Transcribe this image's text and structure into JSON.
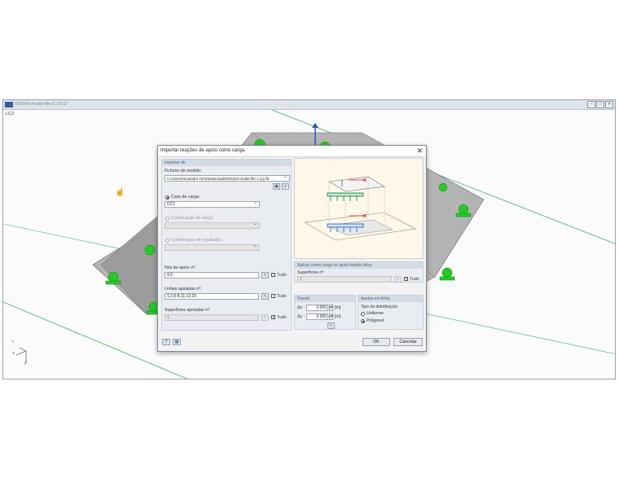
{
  "app": {
    "title": "001643-model-file-2_VCE*",
    "viewport_label": "LC2",
    "axis_labels": {
      "y": "Y",
      "x": "X",
      "z": "Z"
    }
  },
  "dialog": {
    "title": "Importar reações de apoio como carga",
    "close_glyph": "✕",
    "left": {
      "section": "Importar de",
      "model_file_label": "Ficheiro de modelo:",
      "model_file_value": "C:\\Users\\Alexandra Yuhn\\Downloads\\001643-model-file-1 (1).rf5",
      "load_case": {
        "label": "Caso de carga:",
        "value": "CC1"
      },
      "load_combination": {
        "label": "Combinação de carga:"
      },
      "result_combination": {
        "label": "Combinação de resultados:"
      },
      "nodes": {
        "label": "Nós de apoio nº:",
        "value": "4,5",
        "all_label": "Tudo"
      },
      "lines": {
        "label": "Linhas apoiadas nº:",
        "value": "1,2,6-8,11,13,15",
        "all_label": "Tudo"
      },
      "surfaces": {
        "label": "Superfícies apoiadas nº:",
        "value": "1",
        "all_label": "Tudo"
      }
    },
    "right": {
      "apply_section": "Aplicar como carga no atual modelo ativo",
      "surfaces_label": "Superfícies nº:",
      "surfaces_value": "1",
      "all_label": "Tudo",
      "offset_section": "Desvio",
      "dx_label": "Δx :",
      "dx_value": "0.000",
      "dy_label": "Δy :",
      "dy_value": "0.000",
      "unit": "[m]",
      "line_section": "Apoios em linha",
      "distribution_label": "Tipo de distribuição:",
      "uniform_label": "Uniforme",
      "polygonal_label": "Poligonal"
    },
    "footer": {
      "ok": "OK",
      "cancel": "Cancelar"
    }
  }
}
